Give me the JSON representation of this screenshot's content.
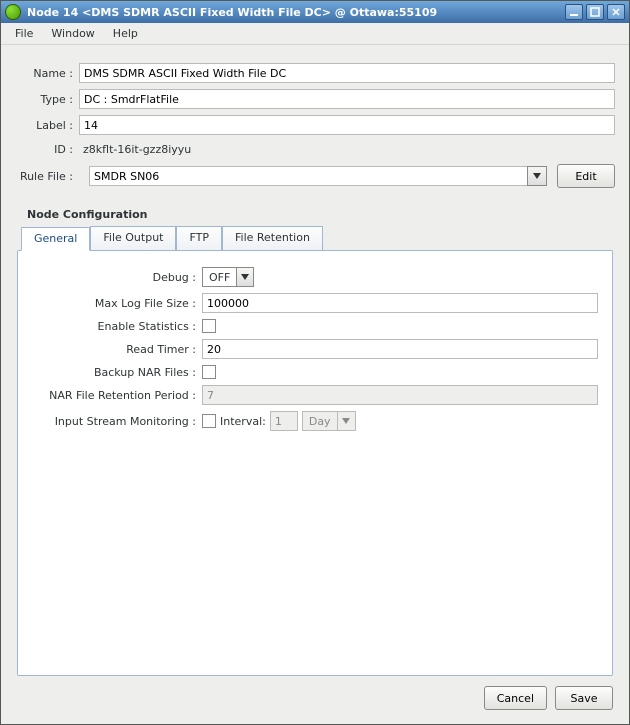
{
  "window": {
    "title": "Node 14 <DMS SDMR ASCII Fixed Width File DC> @ Ottawa:55109"
  },
  "menubar": {
    "file": "File",
    "window": "Window",
    "help": "Help"
  },
  "form": {
    "name_label": "Name :",
    "name_value": "DMS SDMR ASCII Fixed Width File DC",
    "type_label": "Type :",
    "type_value": "DC : SmdrFlatFile",
    "label_label": "Label :",
    "label_value": "14",
    "id_label": "ID :",
    "id_value": "z8kflt-16it-gzz8iyyu",
    "rule_label": "Rule File :",
    "rule_value": "SMDR SN06",
    "edit_label": "Edit"
  },
  "section": {
    "title": "Node Configuration"
  },
  "tabs": {
    "general": "General",
    "file_output": "File Output",
    "ftp": "FTP",
    "file_retention": "File Retention"
  },
  "config": {
    "debug_label": "Debug :",
    "debug_value": "OFF",
    "maxlog_label": "Max Log File Size :",
    "maxlog_value": "100000",
    "stats_label": "Enable Statistics :",
    "readtimer_label": "Read Timer :",
    "readtimer_value": "20",
    "backup_label": "Backup NAR Files :",
    "retention_label": "NAR File Retention Period :",
    "retention_value": "7",
    "monitor_label": "Input Stream Monitoring :",
    "interval_label": "Interval:",
    "interval_value": "1",
    "interval_unit": "Day"
  },
  "footer": {
    "cancel": "Cancel",
    "save": "Save"
  }
}
